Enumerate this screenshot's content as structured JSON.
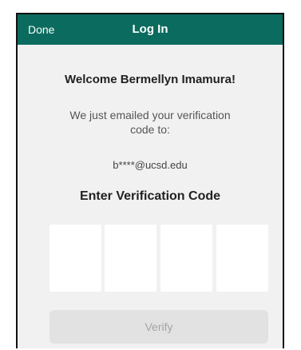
{
  "navbar": {
    "done_label": "Done",
    "title": "Log In",
    "color": "#0b6b5e"
  },
  "content": {
    "welcome": "Welcome Bermellyn Imamura!",
    "emailed_message": "We just emailed your verification code to:",
    "email": "b****@ucsd.edu",
    "enter_code_heading": "Enter Verification Code",
    "code_digits": [
      "",
      "",
      "",
      ""
    ]
  },
  "verify_button": {
    "label": "Verify",
    "enabled": false
  },
  "colors": {
    "background": "#f1f1f1",
    "button_disabled_bg": "#e2e2e2",
    "button_disabled_text": "#a4a4a4"
  }
}
